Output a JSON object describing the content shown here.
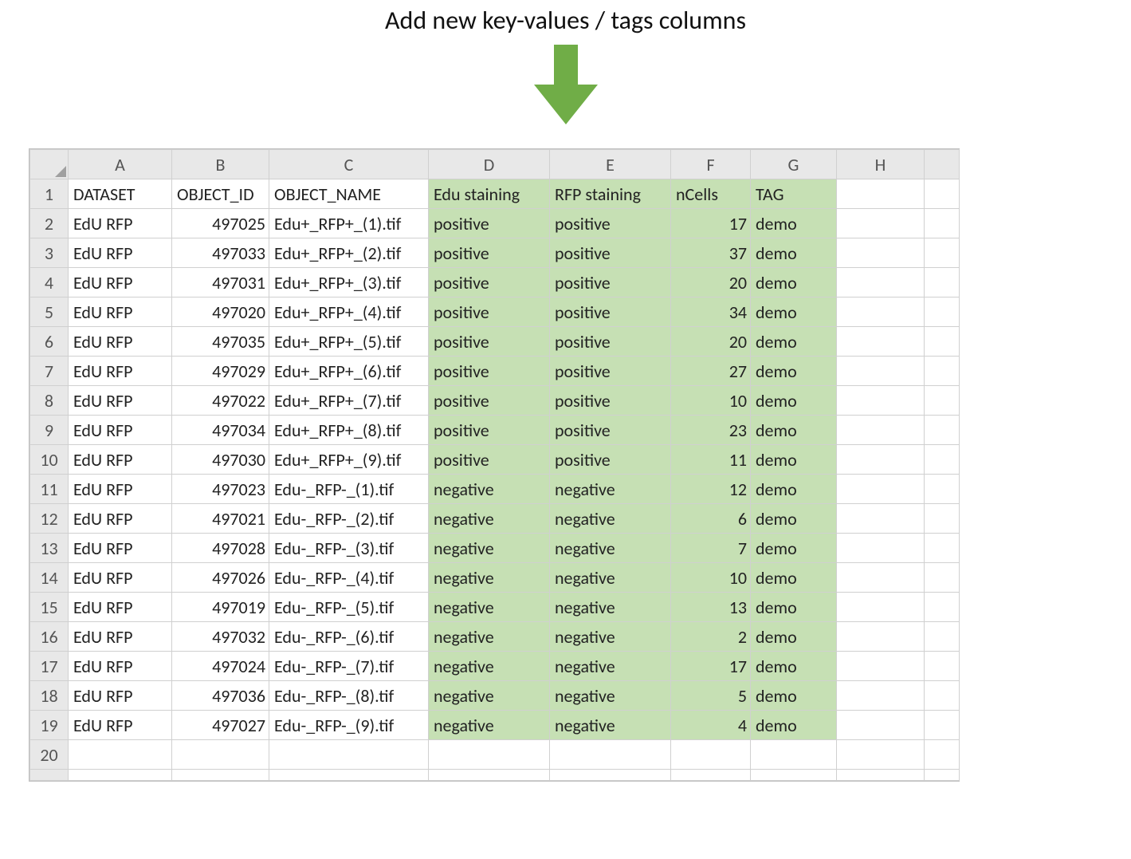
{
  "annotation": {
    "title": "Add new key-values / tags columns",
    "arrow_color": "#70ad47"
  },
  "spreadsheet": {
    "col_letters": [
      "A",
      "B",
      "C",
      "D",
      "E",
      "F",
      "G",
      "H",
      ""
    ],
    "highlighted_cols": [
      "D",
      "E",
      "F",
      "G"
    ],
    "headers": {
      "A": "DATASET",
      "B": "OBJECT_ID",
      "C": "OBJECT_NAME",
      "D": "Edu staining",
      "E": "RFP staining",
      "F": "nCells",
      "G": "TAG",
      "H": ""
    },
    "rows": [
      {
        "n": "1"
      },
      {
        "n": "2",
        "A": "EdU RFP",
        "B": "497025",
        "C": "Edu+_RFP+_(1).tif",
        "D": "positive",
        "E": "positive",
        "F": "17",
        "G": "demo"
      },
      {
        "n": "3",
        "A": "EdU RFP",
        "B": "497033",
        "C": "Edu+_RFP+_(2).tif",
        "D": "positive",
        "E": "positive",
        "F": "37",
        "G": "demo"
      },
      {
        "n": "4",
        "A": "EdU RFP",
        "B": "497031",
        "C": "Edu+_RFP+_(3).tif",
        "D": "positive",
        "E": "positive",
        "F": "20",
        "G": "demo"
      },
      {
        "n": "5",
        "A": "EdU RFP",
        "B": "497020",
        "C": "Edu+_RFP+_(4).tif",
        "D": "positive",
        "E": "positive",
        "F": "34",
        "G": "demo"
      },
      {
        "n": "6",
        "A": "EdU RFP",
        "B": "497035",
        "C": "Edu+_RFP+_(5).tif",
        "D": "positive",
        "E": "positive",
        "F": "20",
        "G": "demo"
      },
      {
        "n": "7",
        "A": "EdU RFP",
        "B": "497029",
        "C": "Edu+_RFP+_(6).tif",
        "D": "positive",
        "E": "positive",
        "F": "27",
        "G": "demo"
      },
      {
        "n": "8",
        "A": "EdU RFP",
        "B": "497022",
        "C": "Edu+_RFP+_(7).tif",
        "D": "positive",
        "E": "positive",
        "F": "10",
        "G": "demo"
      },
      {
        "n": "9",
        "A": "EdU RFP",
        "B": "497034",
        "C": "Edu+_RFP+_(8).tif",
        "D": "positive",
        "E": "positive",
        "F": "23",
        "G": "demo"
      },
      {
        "n": "10",
        "A": "EdU RFP",
        "B": "497030",
        "C": "Edu+_RFP+_(9).tif",
        "D": "positive",
        "E": "positive",
        "F": "11",
        "G": "demo"
      },
      {
        "n": "11",
        "A": "EdU RFP",
        "B": "497023",
        "C": "Edu-_RFP-_(1).tif",
        "D": "negative",
        "E": "negative",
        "F": "12",
        "G": "demo"
      },
      {
        "n": "12",
        "A": "EdU RFP",
        "B": "497021",
        "C": "Edu-_RFP-_(2).tif",
        "D": "negative",
        "E": "negative",
        "F": "6",
        "G": "demo"
      },
      {
        "n": "13",
        "A": "EdU RFP",
        "B": "497028",
        "C": "Edu-_RFP-_(3).tif",
        "D": "negative",
        "E": "negative",
        "F": "7",
        "G": "demo"
      },
      {
        "n": "14",
        "A": "EdU RFP",
        "B": "497026",
        "C": "Edu-_RFP-_(4).tif",
        "D": "negative",
        "E": "negative",
        "F": "10",
        "G": "demo"
      },
      {
        "n": "15",
        "A": "EdU RFP",
        "B": "497019",
        "C": "Edu-_RFP-_(5).tif",
        "D": "negative",
        "E": "negative",
        "F": "13",
        "G": "demo"
      },
      {
        "n": "16",
        "A": "EdU RFP",
        "B": "497032",
        "C": "Edu-_RFP-_(6).tif",
        "D": "negative",
        "E": "negative",
        "F": "2",
        "G": "demo"
      },
      {
        "n": "17",
        "A": "EdU RFP",
        "B": "497024",
        "C": "Edu-_RFP-_(7).tif",
        "D": "negative",
        "E": "negative",
        "F": "17",
        "G": "demo"
      },
      {
        "n": "18",
        "A": "EdU RFP",
        "B": "497036",
        "C": "Edu-_RFP-_(8).tif",
        "D": "negative",
        "E": "negative",
        "F": "5",
        "G": "demo"
      },
      {
        "n": "19",
        "A": "EdU RFP",
        "B": "497027",
        "C": "Edu-_RFP-_(9).tif",
        "D": "negative",
        "E": "negative",
        "F": "4",
        "G": "demo"
      },
      {
        "n": "20"
      }
    ]
  }
}
